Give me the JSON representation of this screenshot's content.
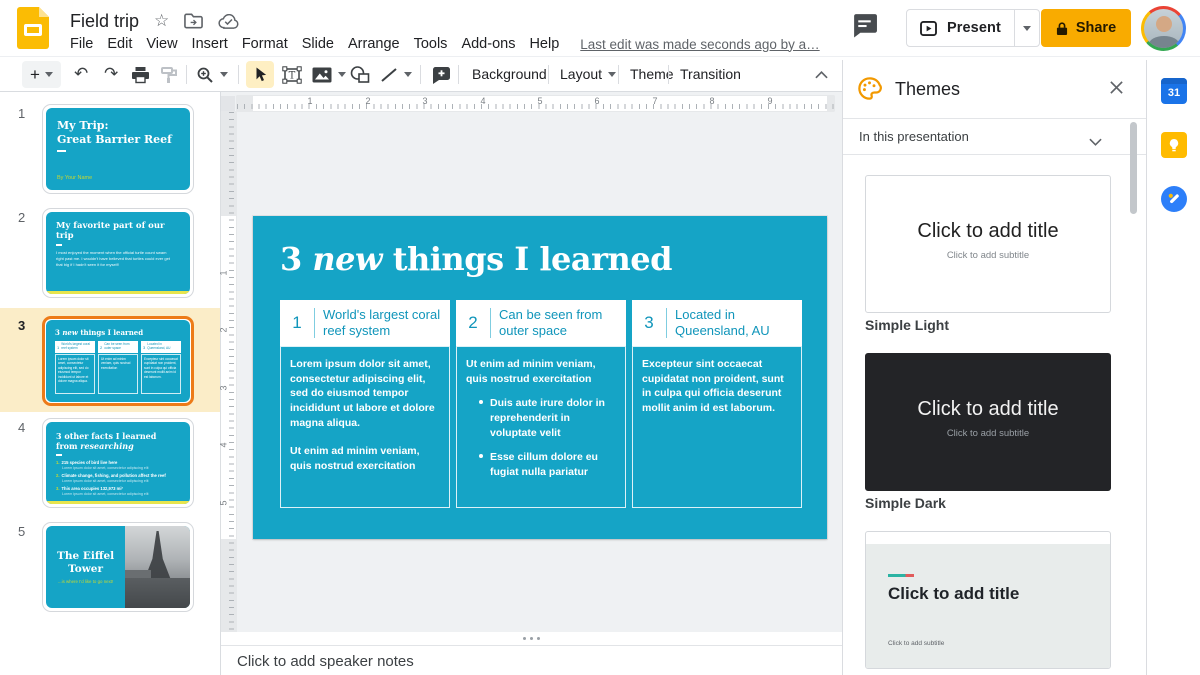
{
  "colors": {
    "slide_teal": "#15A4C6",
    "selected_orange": "#ED7B18",
    "selected_row_bg": "#FBEDC8",
    "share_yellow": "#F9AB00",
    "accent_lime": "#C6D831"
  },
  "header": {
    "title": "Field trip",
    "menus": [
      "File",
      "Edit",
      "View",
      "Insert",
      "Format",
      "Slide",
      "Arrange",
      "Tools",
      "Add-ons",
      "Help"
    ],
    "last_edit": "Last edit was made seconds ago by a…",
    "present_label": "Present",
    "share_label": "Share"
  },
  "toolbar": {
    "background": "Background",
    "layout": "Layout",
    "theme": "Theme",
    "transition": "Transition"
  },
  "rulers": {
    "h": [
      "1",
      "2",
      "3",
      "4",
      "5",
      "6",
      "7",
      "8",
      "9"
    ],
    "v": [
      "1",
      "2",
      "3",
      "4",
      "5"
    ]
  },
  "filmstrip": {
    "slides": [
      {
        "n": "1",
        "line1": "My Trip:",
        "line2": "Great Barrier Reef",
        "byline": "By Your Name"
      },
      {
        "n": "2",
        "title": "My favorite part of our trip",
        "body": "I most enjoyed the moment when the official turtle count swam right past me. I wouldn't have believed that turtles could ever get that big if I hadn't seen it for myself!"
      },
      {
        "n": "3"
      },
      {
        "n": "4",
        "title_prefix": "3 other facts I learned from ",
        "title_italic": "researching",
        "items": [
          {
            "n": "1.",
            "head": "215 species of bird live here",
            "sub": "Lorem ipsum dolor sit amet, consectetur adipiscing elit"
          },
          {
            "n": "2.",
            "head": "Climate change, fishing, and pollution affect the reef",
            "sub": "Lorem ipsum dolor sit amet, consectetur adipiscing elit"
          },
          {
            "n": "3.",
            "head": "This area occupies 132,973 mi²",
            "sub": "Lorem ipsum dolor sit amet, consectetur adipiscing elit"
          }
        ]
      },
      {
        "n": "5",
        "line1": "The Eiffel",
        "line2": "Tower",
        "subtitle": "...is where I'd like to go next!"
      }
    ]
  },
  "slide": {
    "title_pre": "3 ",
    "title_italic": "new",
    "title_post": " things I learned",
    "columns": [
      {
        "num": "1",
        "title": "World's largest coral reef system",
        "p1": "Lorem ipsum dolor sit amet, consectetur adipiscing elit, sed do eiusmod tempor incididunt ut labore et dolore magna aliqua.",
        "p2": "Ut enim ad minim veniam, quis nostrud exercitation"
      },
      {
        "num": "2",
        "title": "Can be seen from outer space",
        "p1": "Ut enim ad minim veniam, quis nostrud exercitation",
        "b1": "Duis aute irure dolor in reprehenderit in voluptate velit",
        "b2": "Esse cillum dolore eu fugiat nulla pariatur"
      },
      {
        "num": "3",
        "title": "Located in Queensland, AU",
        "p1": "Excepteur sint occaecat cupidatat non proident, sunt in culpa qui officia deserunt mollit anim id est laborum."
      }
    ]
  },
  "notes": {
    "placeholder": "Click to add speaker notes"
  },
  "themes": {
    "title": "Themes",
    "section_label": "In this presentation",
    "cards": [
      {
        "label": "Simple Light",
        "title": "Click to add title",
        "subtitle": "Click to add subtitle"
      },
      {
        "label": "Simple Dark",
        "title": "Click to add title",
        "subtitle": "Click to add subtitle"
      },
      {
        "label": "",
        "title": "Click to add title",
        "subtitle": "Click to add subtitle"
      }
    ]
  },
  "side_rail": {
    "calendar_label": "31"
  }
}
